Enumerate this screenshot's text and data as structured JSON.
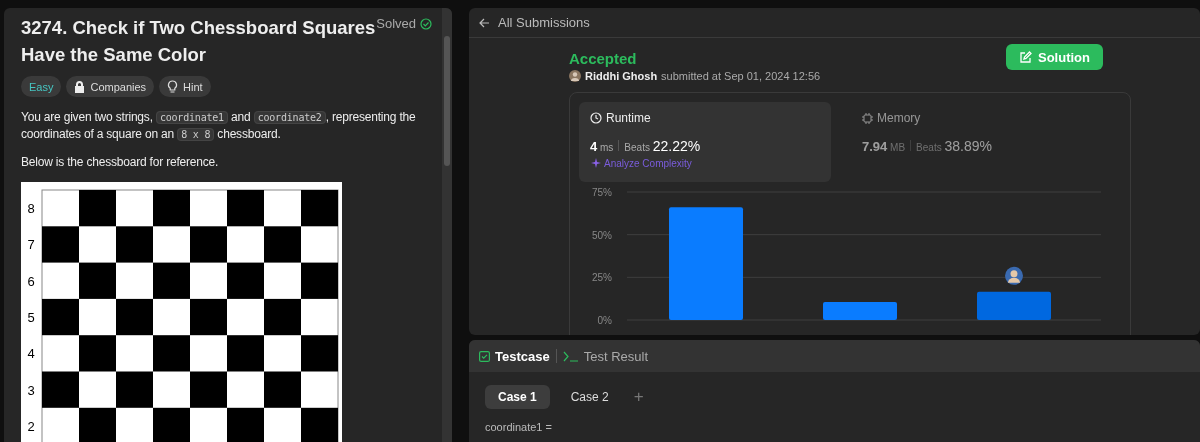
{
  "problem": {
    "title": "3274. Check if Two Chessboard Squares Have the Same Color",
    "status": "Solved",
    "tags": [
      {
        "kind": "difficulty",
        "label": "Easy"
      },
      {
        "kind": "companies",
        "label": "Companies"
      },
      {
        "kind": "hint",
        "label": "Hint"
      }
    ],
    "paragraphs": [
      [
        {
          "kind": "text",
          "text": "You are given two strings, "
        },
        {
          "kind": "code",
          "text": "coordinate1"
        },
        {
          "kind": "text",
          "text": " and "
        },
        {
          "kind": "code",
          "text": "coordinate2"
        },
        {
          "kind": "text",
          "text": ", representing the coordinates of a square on an "
        },
        {
          "kind": "code",
          "text": "8 x 8"
        },
        {
          "kind": "text",
          "text": " chessboard."
        }
      ],
      [
        {
          "kind": "text",
          "text": "Below is the chessboard for reference."
        }
      ]
    ],
    "board_ranks": [
      "8",
      "7",
      "6",
      "5",
      "4",
      "3",
      "2"
    ]
  },
  "submission": {
    "back_label": "All Submissions",
    "verdict": "Accepted",
    "user": "Riddhi Ghosh",
    "submitted": "submitted at Sep 01, 2024 12:56",
    "solution_button": "Solution",
    "metrics": [
      {
        "label": "Runtime",
        "value": "4",
        "unit": "ms",
        "beats_label": "Beats",
        "beats": "22.22%",
        "selected": true
      },
      {
        "label": "Memory",
        "value": "7.94",
        "unit": "MB",
        "beats_label": "Beats",
        "beats": "38.89%",
        "selected": false
      }
    ],
    "analyze_link": "Analyze Complexity",
    "chart_data": {
      "type": "bar",
      "values": [
        66,
        10.5,
        16.5
      ],
      "ylim": [
        0,
        75
      ],
      "yticks": [
        {
          "value": 0,
          "label": "0%"
        },
        {
          "value": 25,
          "label": "25%"
        },
        {
          "value": 50,
          "label": "50%"
        },
        {
          "value": 75,
          "label": "75%"
        }
      ]
    }
  },
  "testcase": {
    "tabs": [
      {
        "label": "Testcase",
        "selected": true
      },
      {
        "label": "Test Result",
        "selected": false
      }
    ],
    "cases": [
      {
        "label": "Case 1",
        "selected": true
      },
      {
        "label": "Case 2",
        "selected": false
      }
    ],
    "add_button": "+",
    "param": "coordinate1 ="
  }
}
